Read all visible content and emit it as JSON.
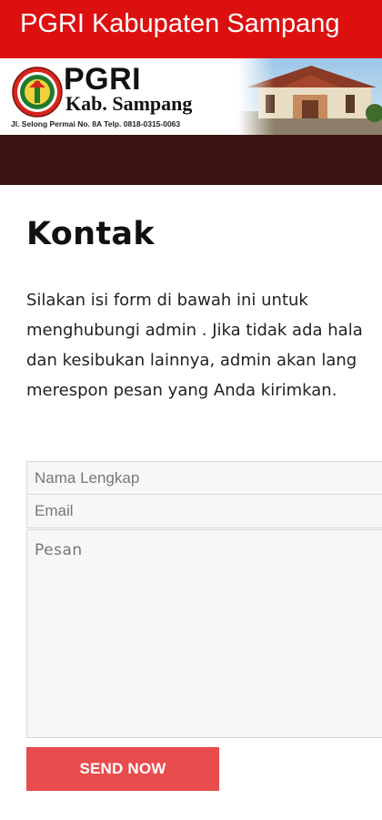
{
  "app_bar": {
    "title": "PGRI Kabupaten Sampang"
  },
  "banner": {
    "org_name": "PGRI",
    "org_sub": "Kab. Sampang",
    "address": "Jl. Selong Permai No. 8A Telp. 0818-0315-0063",
    "logo_icon": "pgri-logo-icon",
    "image": "office-building-photo"
  },
  "page": {
    "title": "Kontak",
    "intro_lines": [
      "Silakan isi form di bawah ini untuk",
      "menghubungi admin . Jika tidak ada hala",
      "dan kesibukan lainnya, admin akan lang",
      "merespon pesan yang Anda kirimkan."
    ]
  },
  "form": {
    "name_placeholder": "Nama Lengkap",
    "email_placeholder": "Email",
    "message_placeholder": "Pesan",
    "submit_label": "SEND NOW"
  },
  "colors": {
    "app_bar": "#dd1010",
    "dark_bar": "#3a1310",
    "button": "#e84c4c"
  }
}
